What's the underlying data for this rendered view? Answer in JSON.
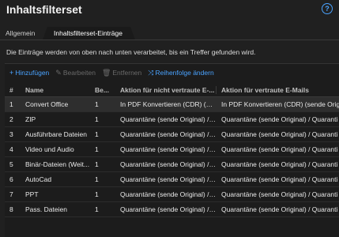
{
  "header": {
    "title": "Inhaltsfilterset",
    "help_glyph": "?"
  },
  "tabs": [
    {
      "label": "Allgemein"
    },
    {
      "label": "Inhaltsfilterset-Einträge"
    }
  ],
  "description": "Die Einträge werden von oben nach unten verarbeitet, bis ein Treffer gefunden wird.",
  "toolbar": {
    "add": {
      "icon": "+",
      "label": "Hinzufügen"
    },
    "edit": {
      "icon": "✎",
      "label": "Bearbeiten"
    },
    "remove": {
      "icon": "🗑",
      "label": "Entfernen"
    },
    "reorder": {
      "icon": "⤨",
      "label": "Reihenfolge ändern"
    }
  },
  "table": {
    "columns": [
      "#",
      "Name",
      "Be...",
      "Aktion für nicht vertraute E-...",
      "Aktion für vertraute E-Mails"
    ],
    "rows": [
      [
        "1",
        "Convert Office",
        "1",
        "In PDF Konvertieren (CDR) (sen...",
        "In PDF Konvertieren (CDR) (sende Origi"
      ],
      [
        "2",
        "ZIP",
        "1",
        "Quarantäne (sende Original) / ...",
        "Quarantäne (sende Original) / Quaranti"
      ],
      [
        "3",
        "Ausführbare Dateien",
        "1",
        "Quarantäne (sende Original) / ...",
        "Quarantäne (sende Original) / Quaranti"
      ],
      [
        "4",
        "Video und Audio",
        "1",
        "Quarantäne (sende Original) / ...",
        "Quarantäne (sende Original) / Quaranti"
      ],
      [
        "5",
        "Binär-Dateien (Weit...",
        "1",
        "Quarantäne (sende Original) / ...",
        "Quarantäne (sende Original) / Quaranti"
      ],
      [
        "6",
        "AutoCad",
        "1",
        "Quarantäne (sende Original) / ...",
        "Quarantäne (sende Original) / Quaranti"
      ],
      [
        "7",
        "PPT",
        "1",
        "Quarantäne (sende Original) / ...",
        "Quarantäne (sende Original) / Quaranti"
      ],
      [
        "8",
        "Pass. Dateien",
        "1",
        "Quarantäne (sende Original) / ...",
        "Quarantäne (sende Original) / Quaranti"
      ]
    ]
  },
  "colors": {
    "accent": "#4aa3ff",
    "background": "#202020"
  }
}
